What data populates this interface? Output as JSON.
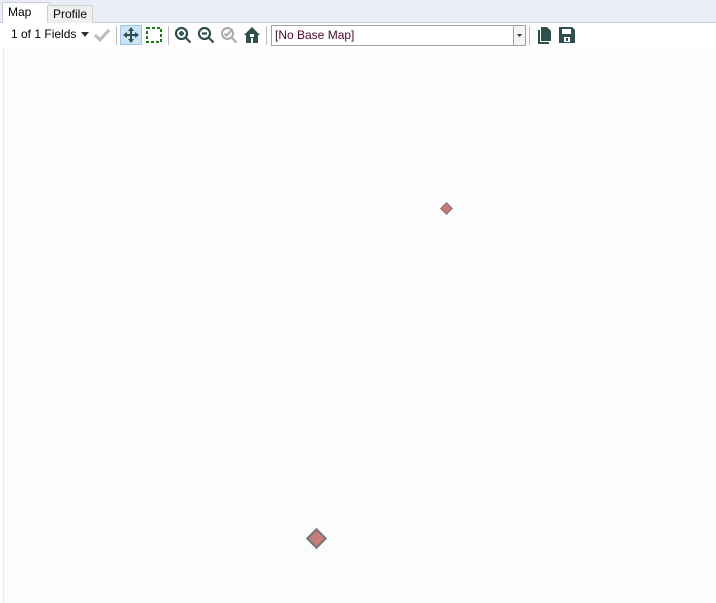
{
  "tabs": [
    {
      "label": "Map"
    },
    {
      "label": "Profile"
    }
  ],
  "toolbar": {
    "fields_label": "1 of 1 Fields",
    "basemap": "[No Base Map]"
  },
  "colors": {
    "point": "#c77c7c",
    "icon": "#2f4f4f"
  }
}
